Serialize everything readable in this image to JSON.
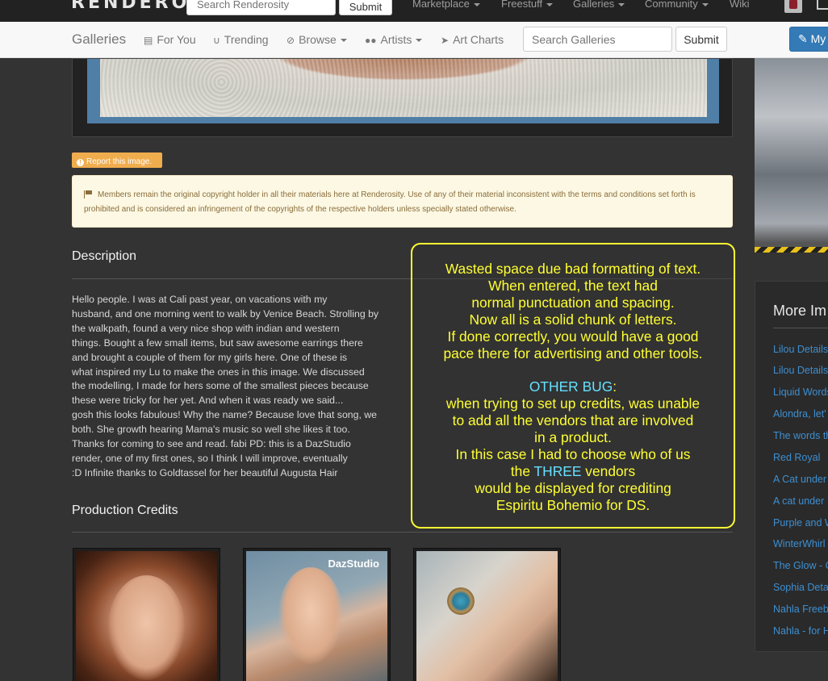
{
  "topnav": {
    "logo": "RENDEROSITY",
    "search_placeholder": "Search Renderosity",
    "submit_label": "Submit",
    "menu": [
      {
        "label": "Marketplace",
        "has_caret": true
      },
      {
        "label": "Freestuff",
        "has_caret": true
      },
      {
        "label": "Galleries",
        "has_caret": true
      },
      {
        "label": "Community",
        "has_caret": true
      },
      {
        "label": "Wiki",
        "has_caret": false
      }
    ]
  },
  "subnav": {
    "brand": "Galleries",
    "items": [
      {
        "label": "For You",
        "icon": "document-icon"
      },
      {
        "label": "Trending",
        "icon": "magnet-icon"
      },
      {
        "label": "Browse",
        "icon": "compass-icon"
      },
      {
        "label": "Artists",
        "icon": "users-icon"
      },
      {
        "label": "Art Charts",
        "icon": "rocket-icon"
      }
    ],
    "search_placeholder": "Search Galleries",
    "submit_label": "Submit",
    "my_button_label": "My"
  },
  "report_label": "Report this image.",
  "copyright_notice": "Members remain the original copyright holder in all their materials here at Renderosity. Use of any of their material inconsistent with the terms and conditions set forth is prohibited and is considered an infringement of the copyrights of the respective holders unless specially stated otherwise.",
  "description": {
    "title": "Description",
    "text": "Hello people. I was at Cali past year, on vacations with my\nhusband, and one morning went to walk by Venice Beach. Strolling by\nthe walkpath, found a very nice shop with indian and western\nthings. Bought a few small items, but saw awesome earrings there\nand brought a couple of them for my girls here. One of these is\nwhat inspired my Lu to make the ones in this image. We discussed\nthe modelling, I made for hers some of the smallest pieces because\nthese were tricky for her yet. And when it was ready we said...\ngosh this looks fabulous! Why the name? Because love that song, we\nboth. She growth hearing Mama's music so well she likes it too.\nThanks for coming to see and read. fabi PD: this is a DazStudio\nrender, one of my first ones, so I think I will improve, eventually\n:D Infinite thanks to Goldtassel for her beautiful Augusta Hair"
  },
  "annotation": {
    "lines_part1": [
      "Wasted space due bad formatting of text.",
      "When entered, the text had",
      "normal punctuation and spacing.",
      "Now all is a solid chunk of letters.",
      "If done correctly, you would have a good",
      "pace there for advertising and other tools."
    ],
    "other_bug_label": "OTHER BUG",
    "other_bug_colon": ":",
    "lines_part2": [
      "when trying to set up credits, was unable",
      "to add all the vendors that are involved",
      "in a product.",
      "In this case I had to choose who of us"
    ],
    "the_prefix": "the ",
    "three_word": "THREE",
    "vendors_suffix": " vendors",
    "lines_part3": [
      "would be displayed for crediting",
      "Espiritu Bohemio for DS."
    ]
  },
  "production_credits": {
    "title": "Production Credits",
    "cards": [
      {
        "label": ""
      },
      {
        "label": "DazStudio"
      },
      {
        "label": ""
      }
    ]
  },
  "sidebar": {
    "more_title": "More Im",
    "links": [
      "Lilou Details",
      "Lilou Details",
      "Liquid Words",
      "Alondra, let'",
      "The words th",
      "Red Royal",
      "A Cat under",
      "A cat under",
      "Purple and W",
      "WinterWhirl",
      "The Glow - C",
      "Sophia Deta",
      "Nahla Freeb",
      "Nahla - for H"
    ]
  },
  "colors": {
    "page_bg": "#333333",
    "annotation": "#ffff33",
    "annotation_highlight": "#66e0ff",
    "link": "#3d8fd1",
    "report": "#f0ad4e",
    "notice_bg": "#fcf8e3"
  }
}
